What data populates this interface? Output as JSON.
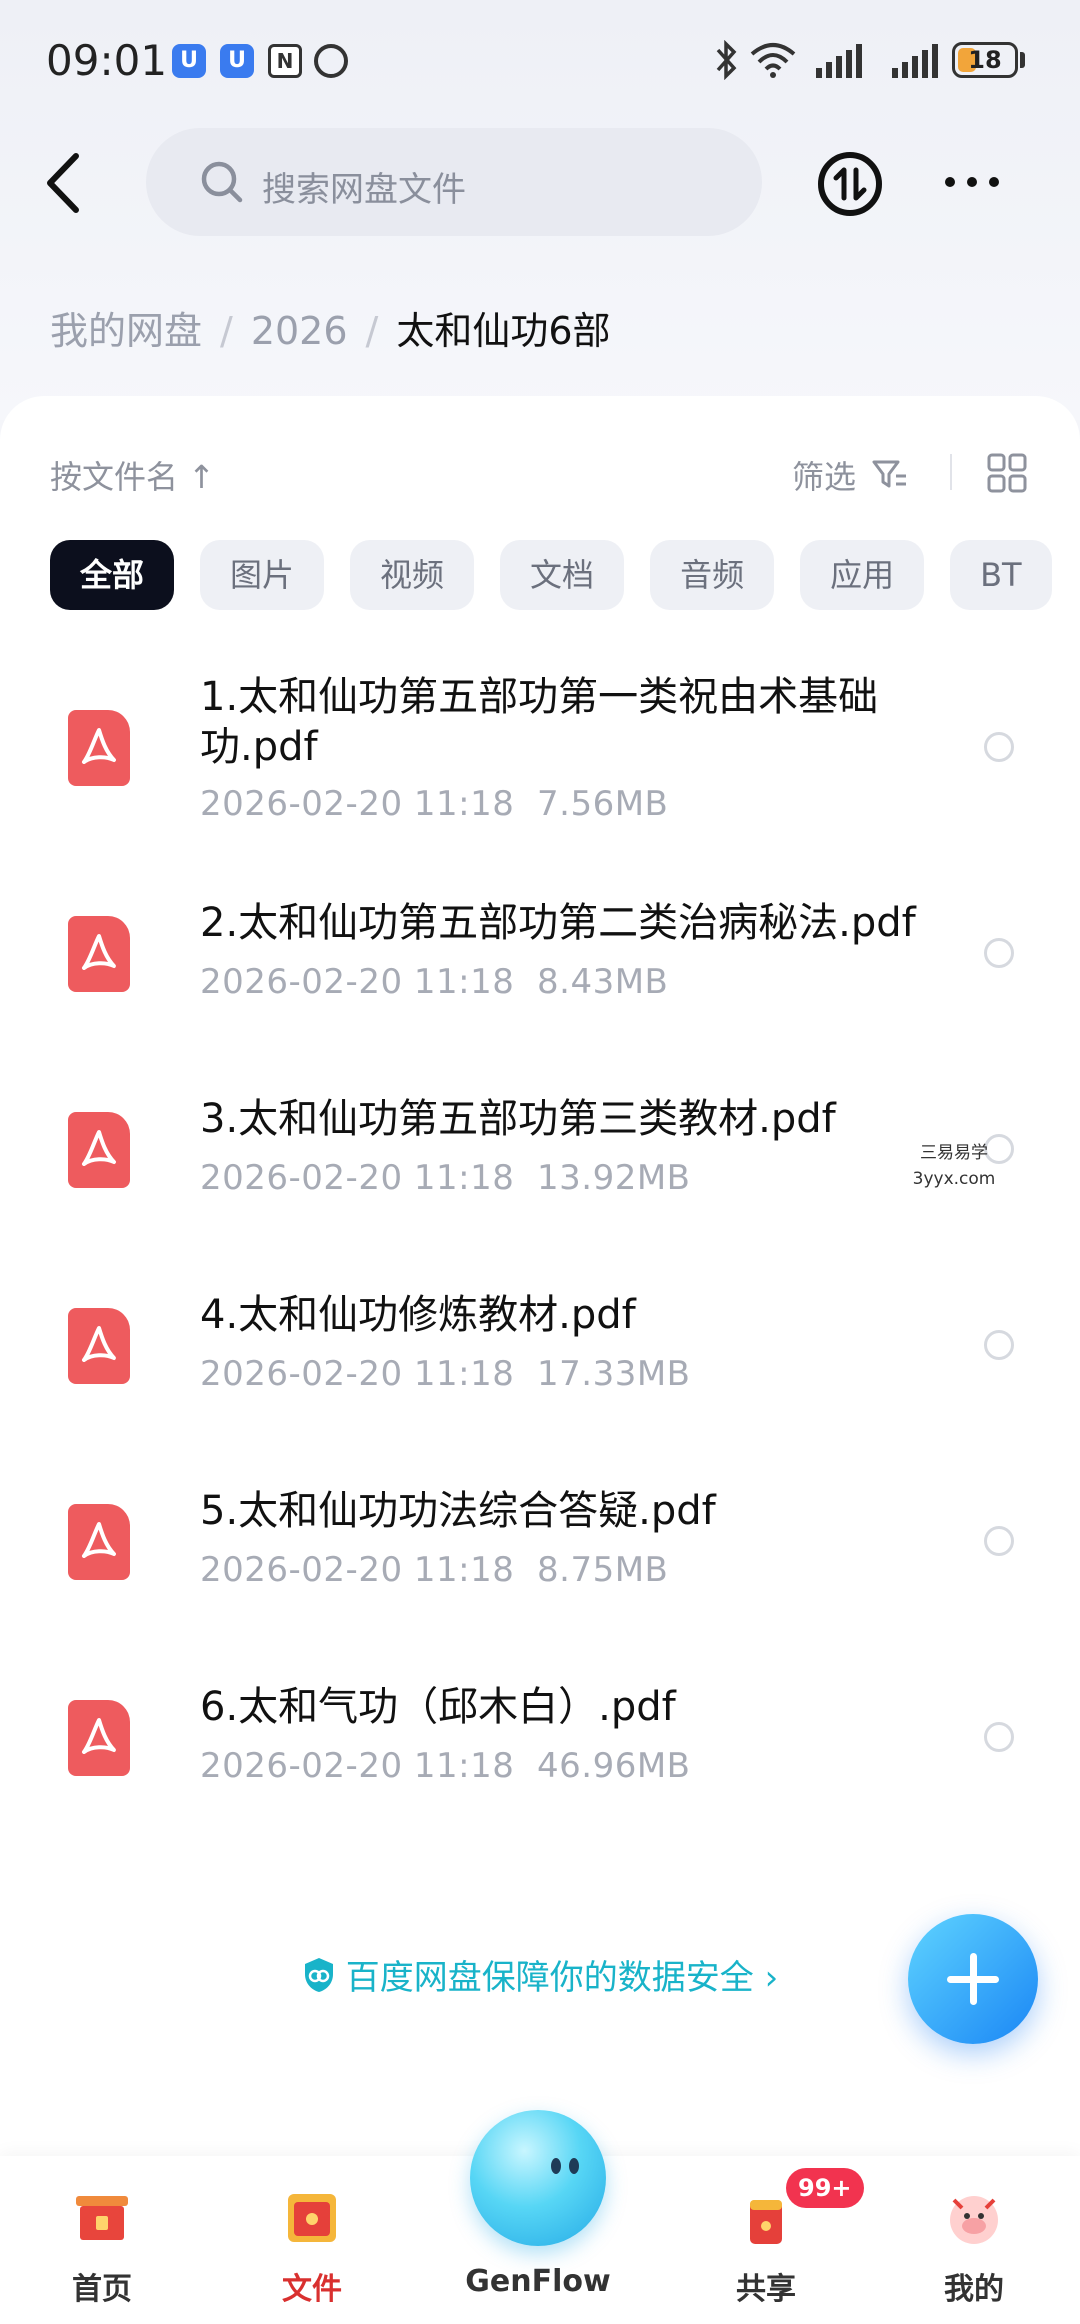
{
  "status_bar": {
    "time": "09:01",
    "battery": "18"
  },
  "header": {
    "search_placeholder": "搜索网盘文件"
  },
  "breadcrumb": {
    "items": [
      "我的网盘",
      "2026"
    ],
    "current": "太和仙功6部"
  },
  "toolbar": {
    "sort_label": "按文件名 ↑",
    "filter_label": "筛选"
  },
  "chips": [
    "全部",
    "图片",
    "视频",
    "文档",
    "音频",
    "应用",
    "BT"
  ],
  "files": [
    {
      "name": "1.太和仙功第五部功第一类祝由术基础功.pdf",
      "date": "2026-02-20  11:18",
      "size": "7.56MB"
    },
    {
      "name": "2.太和仙功第五部功第二类治病秘法.pdf",
      "date": "2026-02-20  11:18",
      "size": "8.43MB"
    },
    {
      "name": "3.太和仙功第五部功第三类教材.pdf",
      "date": "2026-02-20  11:18",
      "size": "13.92MB"
    },
    {
      "name": "4.太和仙功修炼教材.pdf",
      "date": "2026-02-20  11:18",
      "size": "17.33MB"
    },
    {
      "name": "5.太和仙功功法综合答疑.pdf",
      "date": "2026-02-20  11:18",
      "size": "8.75MB"
    },
    {
      "name": "6.太和气功（邱木白）.pdf",
      "date": "2026-02-20  11:18",
      "size": "46.96MB"
    }
  ],
  "watermark": {
    "line1": "三易易学",
    "line2": "3yyx.com"
  },
  "safety_text": "百度网盘保障你的数据安全 ›",
  "bottom_nav": {
    "home": "首页",
    "files": "文件",
    "genflow": "GenFlow",
    "share": "共享",
    "mine": "我的",
    "share_badge": "99+"
  },
  "colors": {
    "accent": "#d9302f",
    "pdf": "#ee5b5e",
    "fab": "#1a86f5",
    "safety": "#19b3c9"
  }
}
